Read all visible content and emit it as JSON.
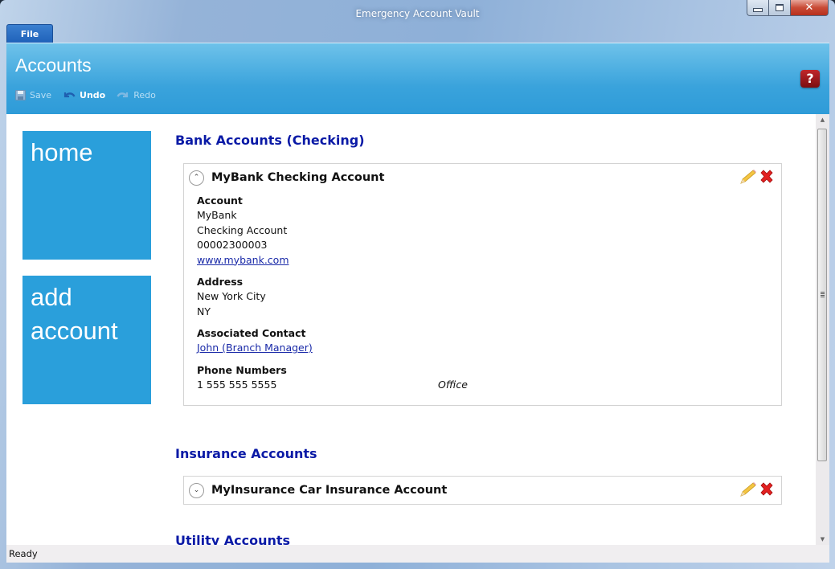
{
  "window": {
    "title": "Emergency Account Vault",
    "controls": {
      "minimize": "minimize",
      "maximize": "maximize",
      "close": "✕"
    }
  },
  "menu": {
    "file_tab": "File"
  },
  "ribbon": {
    "title": "Accounts",
    "toolbar": [
      {
        "label": "Save",
        "icon": "save-icon",
        "enabled": false
      },
      {
        "label": "Undo",
        "icon": "undo-icon",
        "enabled": true
      },
      {
        "label": "Redo",
        "icon": "redo-icon",
        "enabled": false
      }
    ],
    "help_label": "?"
  },
  "nav_tiles": [
    {
      "label": "home"
    },
    {
      "label": "add account"
    }
  ],
  "sections": [
    {
      "heading": "Bank Accounts (Checking)",
      "cards": [
        {
          "title": "MyBank Checking Account",
          "expanded": true,
          "fields": {
            "account_label": "Account",
            "account_lines": [
              "MyBank",
              "Checking Account",
              "00002300003"
            ],
            "account_link": "www.mybank.com",
            "address_label": "Address",
            "address_lines": [
              "New York City",
              "NY"
            ],
            "contact_label": "Associated Contact",
            "contact_link": "John (Branch Manager)",
            "phones_label": "Phone Numbers",
            "phones": [
              {
                "number": "1 555 555 5555",
                "type": "Office"
              }
            ]
          }
        }
      ]
    },
    {
      "heading": "Insurance Accounts",
      "cards": [
        {
          "title": "MyInsurance Car Insurance Account",
          "expanded": false
        }
      ]
    },
    {
      "heading": "Utility Accounts",
      "cards": []
    }
  ],
  "status": {
    "text": "Ready"
  },
  "colors": {
    "accent": "#2a9fdb",
    "heading": "#0a1aa6",
    "link": "#1a2aa8",
    "help": "#9b1518"
  }
}
